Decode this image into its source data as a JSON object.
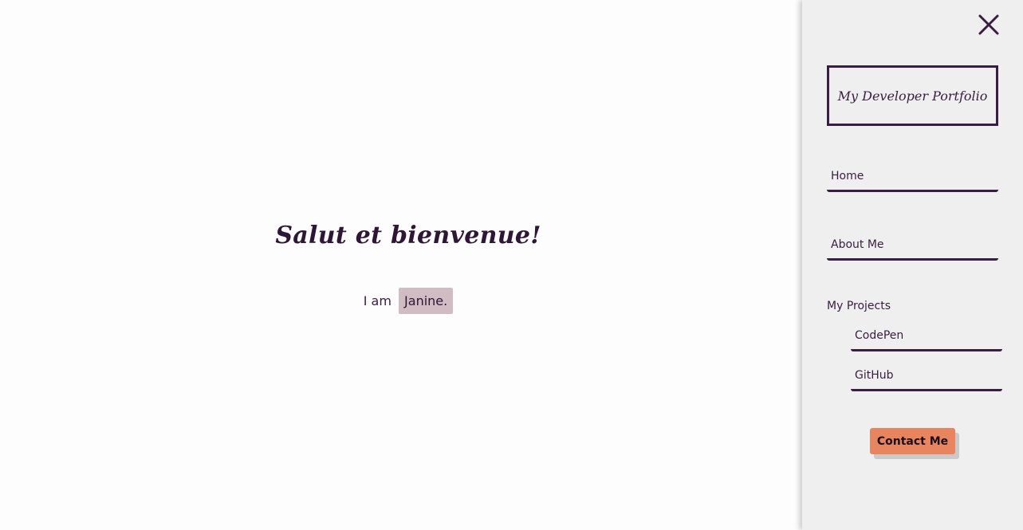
{
  "hero": {
    "title": "Salut et bienvenue!",
    "intro_prefix": "I am",
    "name": "Janine."
  },
  "sidebar": {
    "close_icon": "close-icon",
    "brand": "My Developer Portfolio",
    "nav": {
      "home": "Home",
      "about": "About Me",
      "projects_label": "My Projects",
      "codepen": "CodePen",
      "github": "GitHub"
    },
    "contact_label": "Contact Me"
  },
  "colors": {
    "accent_dark": "#3a1d42",
    "name_highlight": "#d1bcc4",
    "contact_button": "#e8855e",
    "sidebar_bg": "#efefef"
  }
}
